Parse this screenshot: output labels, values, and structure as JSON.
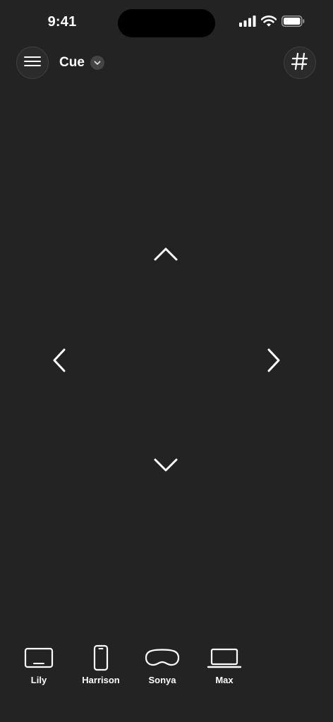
{
  "status_bar": {
    "time": "9:41",
    "icons": [
      "cellular-signal-icon",
      "wifi-icon",
      "battery-icon"
    ]
  },
  "header": {
    "menu_icon": "hamburger-menu-icon",
    "title": "Cue",
    "dropdown_icon": "chevron-down-icon",
    "right_icon": "hashtag-icon"
  },
  "dpad": {
    "up_icon": "chevron-up-icon",
    "down_icon": "chevron-down-icon",
    "left_icon": "chevron-left-icon",
    "right_icon": "chevron-right-icon"
  },
  "devices": [
    {
      "label": "Lily",
      "icon": "tv-icon"
    },
    {
      "label": "Harrison",
      "icon": "phone-icon"
    },
    {
      "label": "Sonya",
      "icon": "vision-headset-icon"
    },
    {
      "label": "Max",
      "icon": "laptop-icon"
    }
  ],
  "colors": {
    "background": "#232323",
    "foreground": "#ffffff",
    "button_fill": "#2b2b2b",
    "button_border": "#3e3e3e"
  }
}
